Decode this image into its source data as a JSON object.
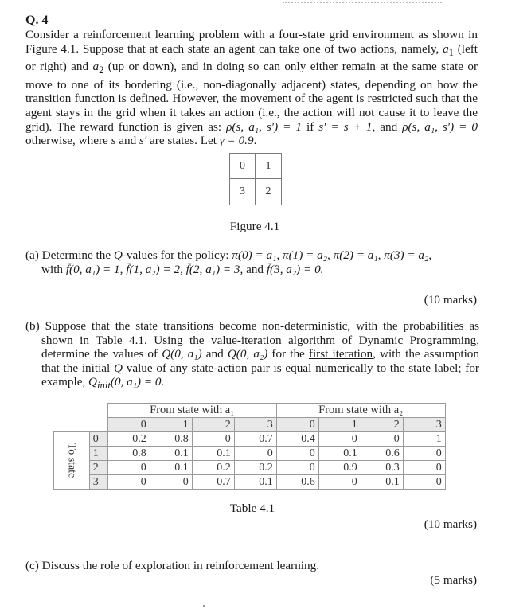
{
  "question": {
    "number": "Q. 4",
    "intro": {
      "s1": "Consider a reinforcement learning problem with a four-state grid environment as shown in Figure 4.1. Suppose that at each state an agent can take one of two actions, namely, ",
      "a1": "a",
      "a1_sub": "1",
      "s2": " (left or right) and ",
      "a2": "a",
      "a2_sub": "2",
      "s3": " (up or down), and in doing so can only either remain at the same state or move to one of its bordering (i.e., non-diagonally adjacent) states, depending on how the transition function is defined. However, the movement of the agent is restricted such that the agent stays in the grid when it takes an action (i.e., the action will not cause it to leave the grid). The reward function is given as: ",
      "reward1": "ρ(s, a₁, s′) = 1",
      "s4": " if ",
      "cond": "s′ = s + 1",
      "s5": ", and ",
      "reward0": "ρ(s, a₁, s′) = 0",
      "s6": " otherwise, where ",
      "s_var": "s",
      "s7": " and ",
      "sp_var": "s′",
      "s8": " are states. Let ",
      "gamma": "γ = 0.9",
      "s9": "."
    },
    "figure": {
      "cells": [
        "0",
        "1",
        "3",
        "2"
      ],
      "caption": "Figure 4.1"
    },
    "part_a": {
      "label": "(a)",
      "line1_text": "Determine the ",
      "q": "Q",
      "line1_rest": "-values for the policy: ",
      "policy": "π(0) = a₁, π(1) = a₂, π(2) = a₁, π(3) = a₂,",
      "line2_with": "with ",
      "f_values": "f̄(0, a₁) = 1, f̄(1, a₂) = 2, f̄(2, a₁) = 3,",
      "line2_and": " and ",
      "f_last": "f̄(3, a₂) = 0.",
      "marks": "(10 marks)"
    },
    "part_b": {
      "label": "(b)",
      "t1": "Suppose that the state transitions become non-deterministic, with the probabilities as shown in Table 4.1. Using the value-iteration algorithm of Dynamic Programming, determine the values of ",
      "q01": "Q(0, a₁)",
      "t2": " and ",
      "q02": "Q(0, a₂)",
      "t3": " for the ",
      "underlined": "first iteration",
      "t4": ", with the assumption that the initial ",
      "q": "Q",
      "t5": " value of any state-action pair is equal numerically to the state label; for example, ",
      "qinit": "Q",
      "qinit_sub": "init",
      "qinit_rest": "(0, a₁) = 0.",
      "marks": "(10 marks)"
    },
    "table": {
      "side_label": "To state",
      "group_a1": "From state with a₁",
      "group_a2": "From state with a₂",
      "from_states": [
        "0",
        "1",
        "2",
        "3"
      ],
      "rows": [
        {
          "to": "0",
          "a1": [
            "0.2",
            "0.8",
            "0",
            "0.7"
          ],
          "a2": [
            "0.4",
            "0",
            "0",
            "1"
          ]
        },
        {
          "to": "1",
          "a1": [
            "0.8",
            "0.1",
            "0.1",
            "0"
          ],
          "a2": [
            "0",
            "0.1",
            "0.6",
            "0"
          ]
        },
        {
          "to": "2",
          "a1": [
            "0",
            "0.1",
            "0.2",
            "0.2"
          ],
          "a2": [
            "0",
            "0.9",
            "0.3",
            "0"
          ]
        },
        {
          "to": "3",
          "a1": [
            "0",
            "0",
            "0.7",
            "0.1"
          ],
          "a2": [
            "0.6",
            "0",
            "0.1",
            "0"
          ]
        }
      ],
      "caption": "Table 4.1"
    },
    "part_c": {
      "label": "(c)",
      "text": "Discuss the role of exploration in reinforcement learning.",
      "marks": "(5 marks)"
    }
  }
}
